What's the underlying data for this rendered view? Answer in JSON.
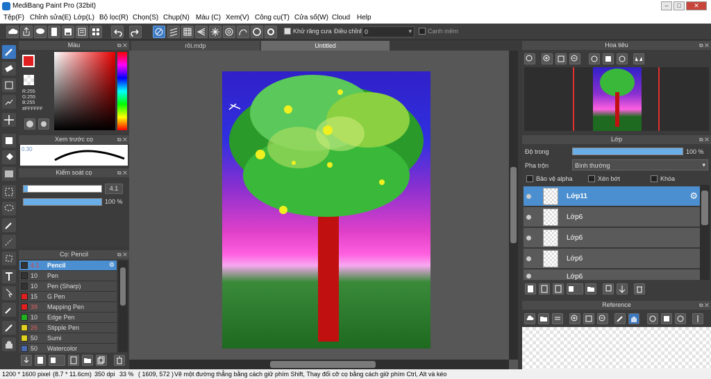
{
  "window": {
    "title": "MediBang Paint Pro (32bit)"
  },
  "menu": [
    "Tệp(F)",
    "Chỉnh sửa(E)",
    "Lớp(L)",
    "Bộ lọc(R)",
    "Chọn(S)",
    "Chụp(N)",
    "Màu (C)",
    "Xem(V)",
    "Công cụ(T)",
    "Cửa số(W)",
    "Cloud",
    "Help"
  ],
  "toolbar": {
    "antialias_label": "Khử răng cưa",
    "correction_label": "Điều chỉnh",
    "correction_value": "0",
    "edge_label": "Cạnh mềm"
  },
  "color_panel": {
    "title": "Màu",
    "r": "R:255",
    "g": "G:255",
    "b": "B:255",
    "hex": "#FFFFFF",
    "foreground": "#e02020",
    "background": "#ffffff"
  },
  "preview_panel": {
    "title": "Xem trước cọ",
    "size": "0.30"
  },
  "brush_control": {
    "title": "Kiểm soát cọ",
    "size": "4.1",
    "opacity": "100 %",
    "opacity_fraction": 1.0
  },
  "brush_panel": {
    "title": "Cọ: Pencil",
    "items": [
      {
        "size": "4.1",
        "name": "Pencil",
        "color": "#333333"
      },
      {
        "size": "10",
        "name": "Pen",
        "color": "#333333"
      },
      {
        "size": "10",
        "name": "Pen (Sharp)",
        "color": "#333333"
      },
      {
        "size": "15",
        "name": "G Pen",
        "color": "#e02020"
      },
      {
        "size": "39",
        "name": "Mapping Pen",
        "color": "#e02020"
      },
      {
        "size": "10",
        "name": "Edge Pen",
        "color": "#20b020"
      },
      {
        "size": "26",
        "name": "Stipple Pen",
        "color": "#e0d020"
      },
      {
        "size": "50",
        "name": "Sumi",
        "color": "#e0d020"
      },
      {
        "size": "50",
        "name": "Watercolor",
        "color": "#4a6ab0"
      }
    ]
  },
  "canvas": {
    "tabs": [
      "rồi.mdp",
      "Untitled"
    ],
    "active_tab": "Untitled"
  },
  "navigator": {
    "title": "Hoa tiêu"
  },
  "layer_panel": {
    "title": "Lớp",
    "opacity_label": "Độ trong",
    "opacity_value": "100 %",
    "blend_label": "Pha trộn",
    "blend_value": "Bình thường",
    "protect_alpha": "Bảo vệ alpha",
    "clipping": "Xén bớt",
    "lock": "Khóa",
    "layers": [
      {
        "name": "Lớp11",
        "selected": true
      },
      {
        "name": "Lớp6",
        "selected": false
      },
      {
        "name": "Lớp6",
        "selected": false
      },
      {
        "name": "Lớp6",
        "selected": false
      },
      {
        "name": "Lớp6",
        "selected": false
      }
    ]
  },
  "reference_panel": {
    "title": "Reference"
  },
  "status": {
    "size": "1200 * 1600 pixel",
    "physical": "(8.7 * 11.6cm)",
    "dpi": "350 dpi",
    "zoom": "33 %",
    "coords": "( 1609, 572 )",
    "hint": "Vẽ một đường thẳng bằng cách giữ phím Shift, Thay đổi cỡ cọ bằng cách giữ phím Ctrl, Alt và kéo"
  }
}
